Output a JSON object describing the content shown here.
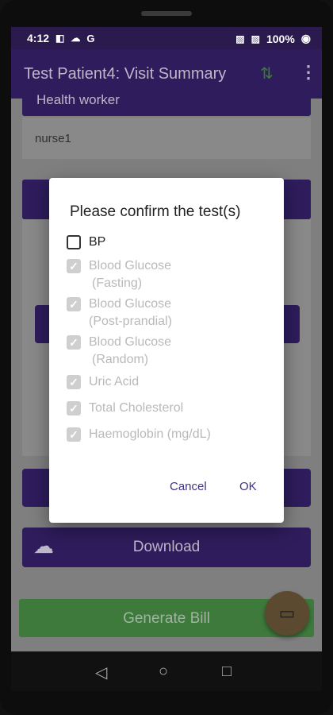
{
  "status": {
    "time": "4:12",
    "battery": "100%"
  },
  "appbar": {
    "title": "Test Patient4: Visit Summary"
  },
  "background": {
    "health_worker_label": "Health worker",
    "health_worker_value": "nurse1",
    "download_label": "Download",
    "generate_bill_label": "Generate Bill"
  },
  "dialog": {
    "title": "Please confirm the test(s)",
    "options": [
      {
        "label": "BP",
        "checked": false,
        "enabled": true
      },
      {
        "label": "Blood Glucose\n(Fasting)",
        "line1": "Blood Glucose",
        "line2": "(Fasting)",
        "checked": true,
        "enabled": false
      },
      {
        "label": "Blood Glucose (Post-prandial)",
        "line1": "Blood Glucose",
        "line2": "(Post-prandial)",
        "checked": true,
        "enabled": false
      },
      {
        "label": "Blood Glucose (Random)",
        "line1": "Blood Glucose",
        "line2": "(Random)",
        "checked": true,
        "enabled": false
      },
      {
        "label": "Uric Acid",
        "checked": true,
        "enabled": false
      },
      {
        "label": "Total Cholesterol",
        "checked": true,
        "enabled": false
      },
      {
        "label": "Haemoglobin (mg/dL)",
        "checked": true,
        "enabled": false
      }
    ],
    "cancel_label": "Cancel",
    "ok_label": "OK"
  }
}
